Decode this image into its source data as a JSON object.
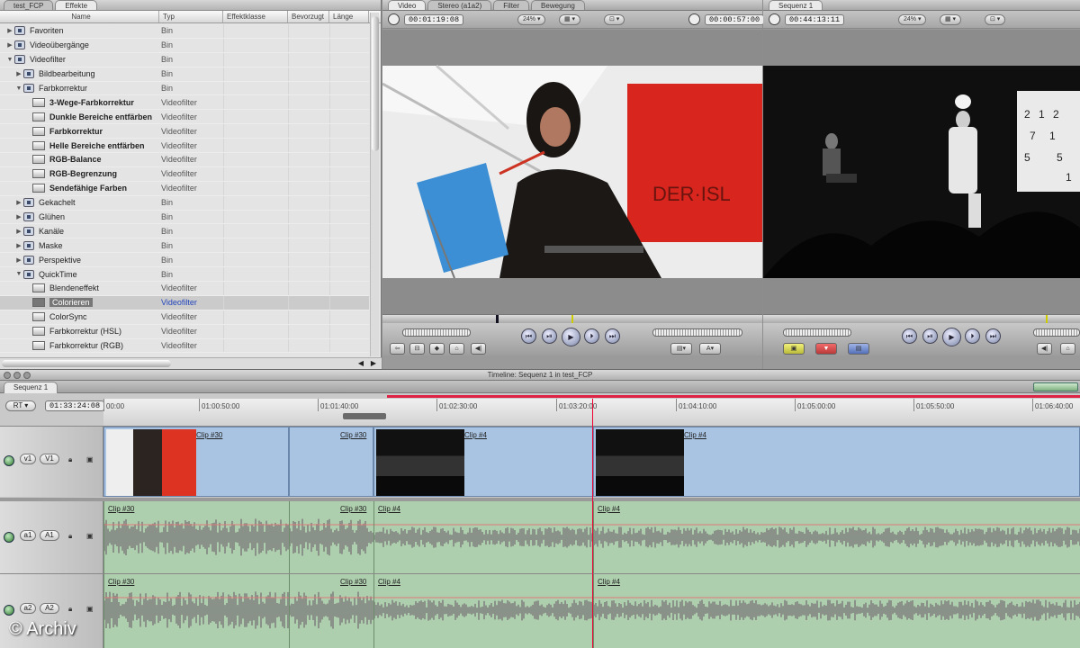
{
  "browser": {
    "tabs": [
      "test_FCP",
      "Effekte"
    ],
    "columns": [
      "Name",
      "Typ",
      "Effektklasse",
      "Bevorzugt",
      "Länge"
    ],
    "rows": [
      {
        "name": "Favoriten",
        "type": "Bin",
        "level": 0,
        "expand": "closed",
        "icon": "bin-icon"
      },
      {
        "name": "Videoübergänge",
        "type": "Bin",
        "level": 0,
        "expand": "closed",
        "icon": "bin-icon"
      },
      {
        "name": "Videofilter",
        "type": "Bin",
        "level": 0,
        "expand": "open",
        "icon": "bin-icon"
      },
      {
        "name": "Bildbearbeitung",
        "type": "Bin",
        "level": 1,
        "expand": "closed",
        "icon": "bin-icon"
      },
      {
        "name": "Farbkorrektur",
        "type": "Bin",
        "level": 1,
        "expand": "open",
        "icon": "bin-icon"
      },
      {
        "name": "3-Wege-Farbkorrektur",
        "type": "Videofilter",
        "level": 2,
        "bold": true,
        "icon": "filter-icon"
      },
      {
        "name": "Dunkle Bereiche entfärben",
        "type": "Videofilter",
        "level": 2,
        "bold": true,
        "icon": "filter-icon"
      },
      {
        "name": "Farbkorrektur",
        "type": "Videofilter",
        "level": 2,
        "bold": true,
        "icon": "filter-icon"
      },
      {
        "name": "Helle Bereiche entfärben",
        "type": "Videofilter",
        "level": 2,
        "bold": true,
        "icon": "filter-icon"
      },
      {
        "name": "RGB-Balance",
        "type": "Videofilter",
        "level": 2,
        "bold": true,
        "icon": "filter-icon"
      },
      {
        "name": "RGB-Begrenzung",
        "type": "Videofilter",
        "level": 2,
        "bold": true,
        "icon": "filter-icon"
      },
      {
        "name": "Sendefähige Farben",
        "type": "Videofilter",
        "level": 2,
        "bold": true,
        "icon": "filter-icon"
      },
      {
        "name": "Gekachelt",
        "type": "Bin",
        "level": 1,
        "expand": "closed",
        "icon": "bin-icon"
      },
      {
        "name": "Glühen",
        "type": "Bin",
        "level": 1,
        "expand": "closed",
        "icon": "bin-icon"
      },
      {
        "name": "Kanäle",
        "type": "Bin",
        "level": 1,
        "expand": "closed",
        "icon": "bin-icon"
      },
      {
        "name": "Maske",
        "type": "Bin",
        "level": 1,
        "expand": "closed",
        "icon": "bin-icon"
      },
      {
        "name": "Perspektive",
        "type": "Bin",
        "level": 1,
        "expand": "closed",
        "icon": "bin-icon"
      },
      {
        "name": "QuickTime",
        "type": "Bin",
        "level": 1,
        "expand": "open",
        "icon": "bin-icon"
      },
      {
        "name": "Blendeneffekt",
        "type": "Videofilter",
        "level": 2,
        "icon": "filter-icon"
      },
      {
        "name": "Colorieren",
        "type": "Videofilter",
        "level": 2,
        "selected": true,
        "icon": "filter-icon"
      },
      {
        "name": "ColorSync",
        "type": "Videofilter",
        "level": 2,
        "icon": "filter-icon"
      },
      {
        "name": "Farbkorrektur (HSL)",
        "type": "Videofilter",
        "level": 2,
        "icon": "filter-icon"
      },
      {
        "name": "Farbkorrektur (RGB)",
        "type": "Videofilter",
        "level": 2,
        "icon": "filter-icon"
      }
    ]
  },
  "viewer": {
    "tabs": [
      "Video",
      "Stereo (a1a2)",
      "Filter",
      "Bewegung"
    ],
    "timecode_left": "00:01:19:08",
    "zoom": "24%",
    "timecode_right": "00:00:57:00"
  },
  "canvas": {
    "tab": "Sequenz 1",
    "timecode": "00:44:13:11",
    "zoom": "24%"
  },
  "timeline": {
    "title": "Timeline: Sequenz 1 in test_FCP",
    "tab": "Sequenz 1",
    "rt_label": "RT",
    "current_timecode": "01:33:24:08",
    "ruler": [
      "00:00",
      "01:00:50:00",
      "01:01:40:00",
      "01:02:30:00",
      "01:03:20:00",
      "01:04:10:00",
      "01:05:00:00",
      "01:05:50:00",
      "01:06:40:00"
    ],
    "video_track": {
      "src": "v1",
      "dst": "V1",
      "clips": [
        "Clip #30",
        "Clip #30",
        "Clip #4",
        "Clip #4"
      ]
    },
    "audio1": {
      "src": "a1",
      "dst": "A1",
      "clips": [
        "Clip #30",
        "Clip #30",
        "Clip #4",
        "Clip #4"
      ]
    },
    "audio2": {
      "src": "a2",
      "dst": "A2",
      "clips": [
        "Clip #30",
        "Clip #30",
        "Clip #4",
        "Clip #4"
      ]
    }
  },
  "watermark": "© Archiv",
  "colors": {
    "video_clip": "#a8c4e2",
    "audio_clip": "#aecfae",
    "playhead": "#e03"
  }
}
